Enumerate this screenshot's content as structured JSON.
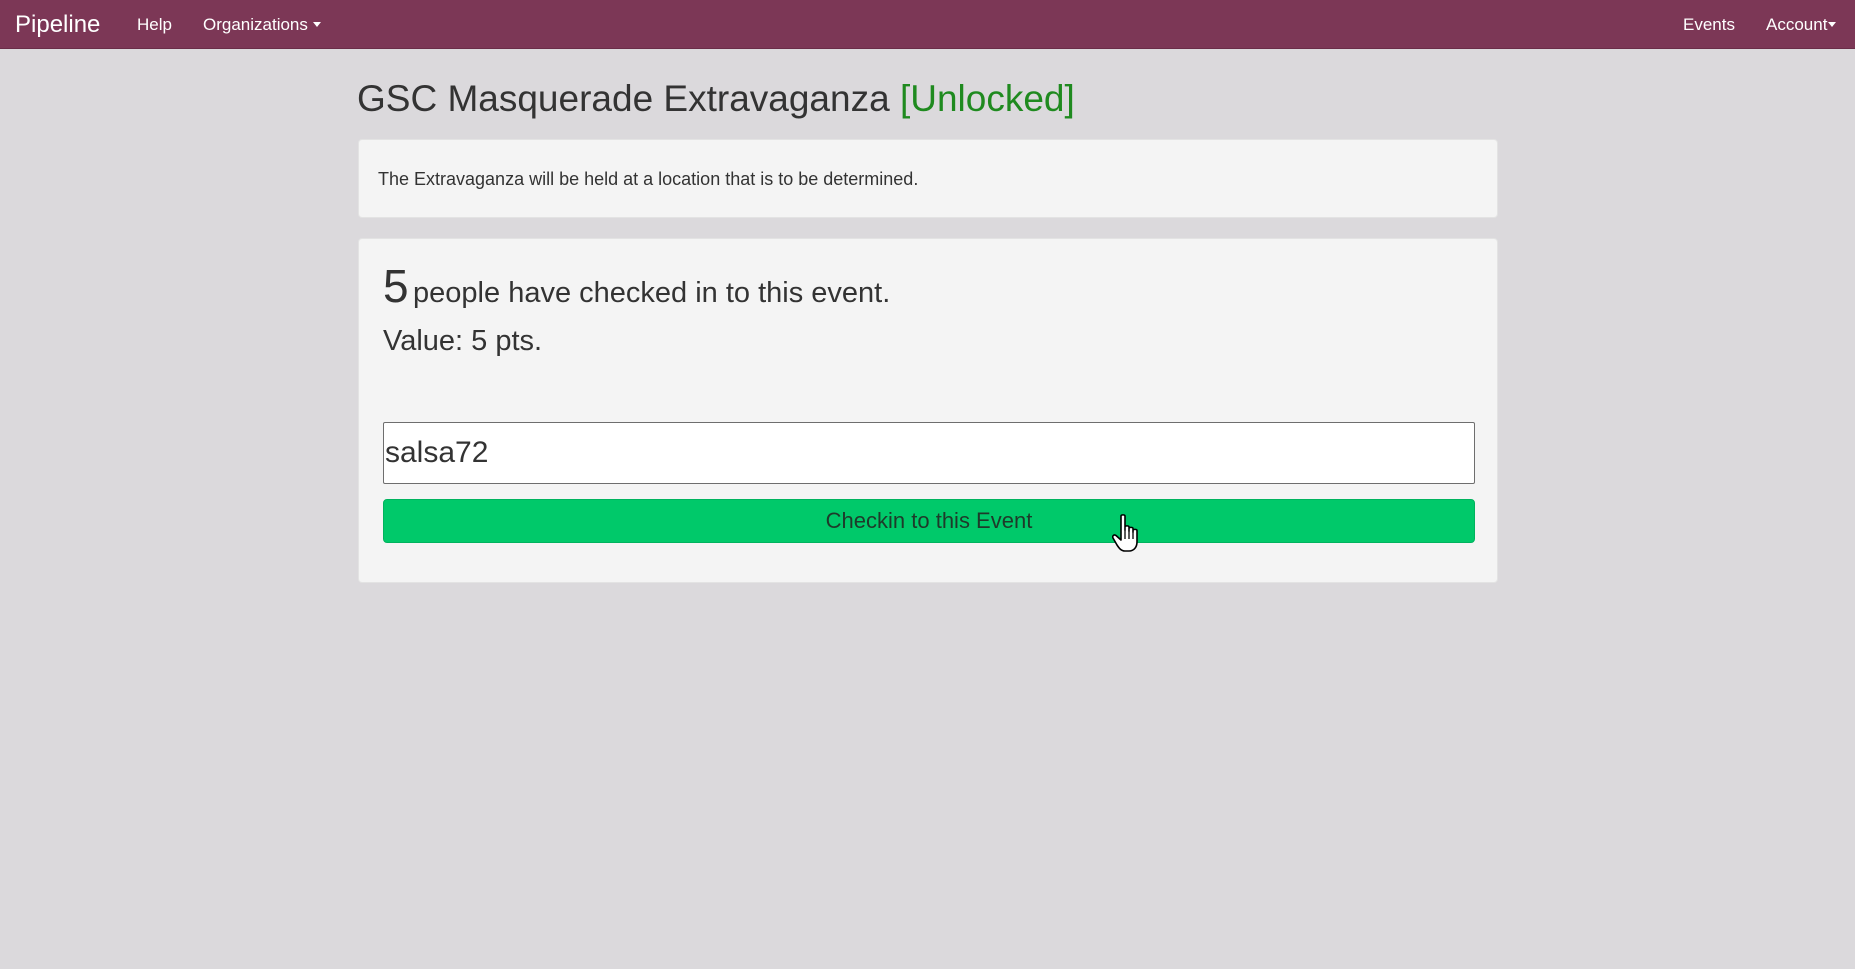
{
  "navbar": {
    "brand": "Pipeline",
    "left_links": [
      "Help",
      "Organizations"
    ],
    "right_links": [
      "Events",
      "Account"
    ],
    "background_color": "#7c3756"
  },
  "event": {
    "title": "GSC Masquerade Extravaganza",
    "status": "[Unlocked]",
    "status_color": "#1f8a1f",
    "description": "The Extravaganza will be held at a location that is to be determined."
  },
  "checkin": {
    "count": "5",
    "count_text": "people have checked in to this event.",
    "value_text": "Value: 5 pts.",
    "input_value": "salsa72",
    "button_label": "Checkin to this Event",
    "button_color": "#00c96a"
  },
  "icons": {
    "cursor": "hand-pointer-cursor-icon",
    "dropdown": "caret-down-icon"
  }
}
